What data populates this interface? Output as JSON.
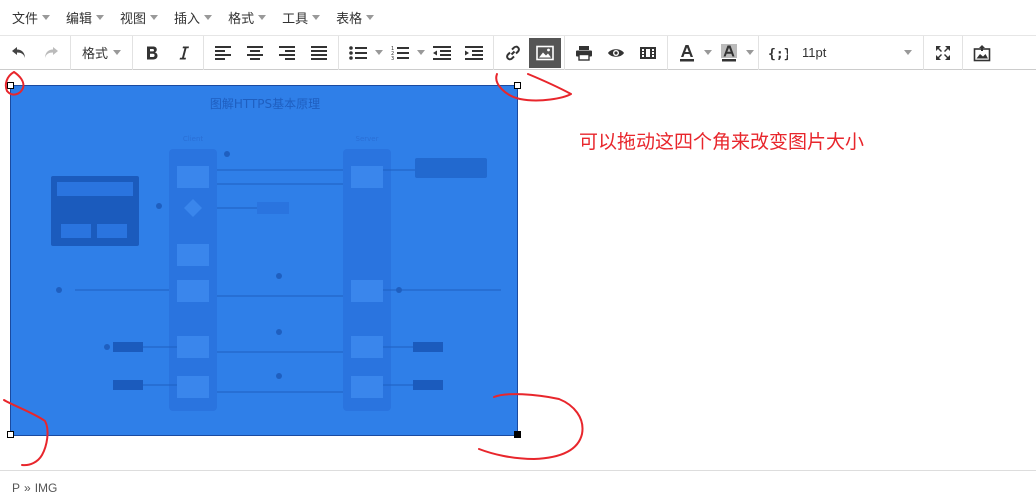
{
  "menubar": {
    "items": [
      {
        "label": "文件"
      },
      {
        "label": "编辑"
      },
      {
        "label": "视图"
      },
      {
        "label": "插入"
      },
      {
        "label": "格式"
      },
      {
        "label": "工具"
      },
      {
        "label": "表格"
      }
    ]
  },
  "toolbar": {
    "format_label": "格式",
    "font_size": "11pt",
    "active_button": "image-button",
    "accent": "#555555"
  },
  "image": {
    "title": "图解HTTPS基本原理",
    "left_column_label": "Client",
    "right_column_label": "Server",
    "fill_color": "#2f7fe8"
  },
  "annotation": {
    "text": "可以拖动这四个角来改变图片大小",
    "color": "#e8262c"
  },
  "statusbar": {
    "path": [
      "P",
      "IMG"
    ],
    "separator": "»"
  }
}
